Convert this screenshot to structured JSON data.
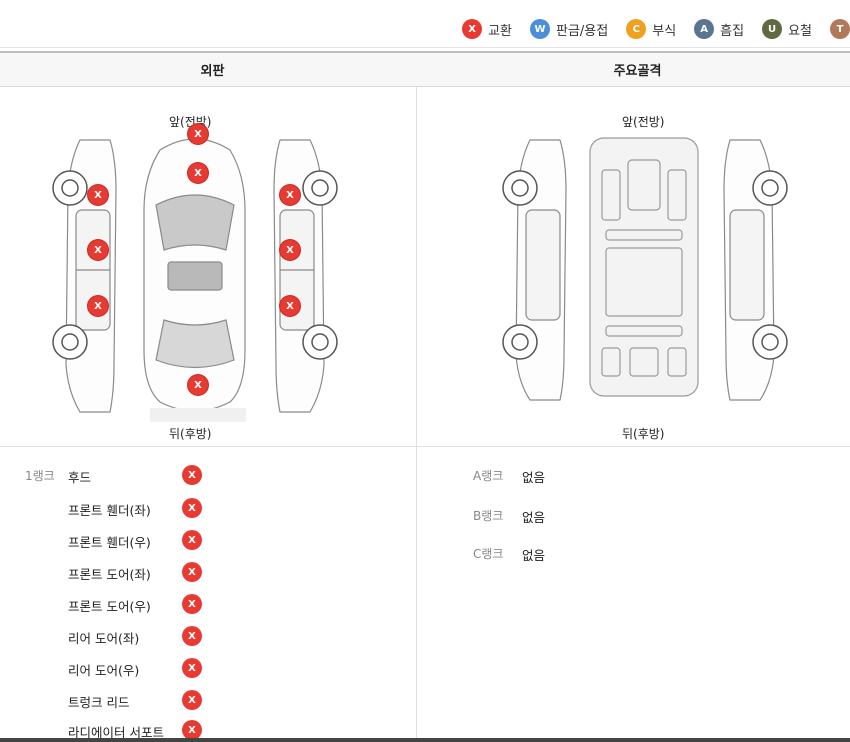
{
  "legend": {
    "items": [
      {
        "code": "X",
        "label": "교환",
        "color": "#e63a32"
      },
      {
        "code": "W",
        "label": "판금/용접",
        "color": "#4a8fd8"
      },
      {
        "code": "C",
        "label": "부식",
        "color": "#f0a020"
      },
      {
        "code": "A",
        "label": "흠집",
        "color": "#5a7590"
      },
      {
        "code": "U",
        "label": "요철",
        "color": "#5f6a40"
      },
      {
        "code": "T",
        "label": "",
        "color": "#b07a5a"
      }
    ]
  },
  "header": {
    "left": "외판",
    "right": "주요골격"
  },
  "exterior_diagram": {
    "front_label": "앞(전방)",
    "rear_label": "뒤(후방)",
    "marker_code": "X",
    "marker_count": 9
  },
  "frame_diagram": {
    "front_label": "앞(전방)",
    "rear_label": "뒤(후방)"
  },
  "exterior_list": {
    "rank_label": "1랭크",
    "parts": [
      {
        "name": "후드",
        "status": "X"
      },
      {
        "name": "프론트 휀더(좌)",
        "status": "X"
      },
      {
        "name": "프론트 휀더(우)",
        "status": "X"
      },
      {
        "name": "프론트 도어(좌)",
        "status": "X"
      },
      {
        "name": "프론트 도어(우)",
        "status": "X"
      },
      {
        "name": "리어 도어(좌)",
        "status": "X"
      },
      {
        "name": "리어 도어(우)",
        "status": "X"
      },
      {
        "name": "트렁크 리드",
        "status": "X"
      },
      {
        "name": "라디에이터 서포트",
        "status": "X"
      }
    ]
  },
  "frame_list": {
    "ranks": [
      {
        "label": "A랭크",
        "value": "없음"
      },
      {
        "label": "B랭크",
        "value": "없음"
      },
      {
        "label": "C랭크",
        "value": "없음"
      }
    ]
  }
}
